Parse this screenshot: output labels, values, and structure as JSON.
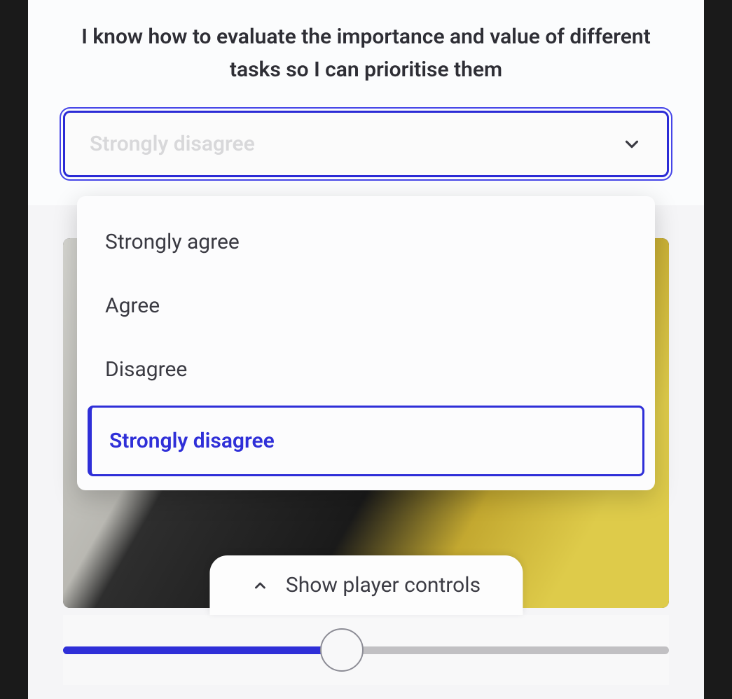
{
  "question": {
    "text": "I know how to evaluate the importance and value of different tasks so I can prioritise them"
  },
  "select": {
    "placeholder": "Strongly disagree",
    "options": [
      {
        "label": "Strongly agree",
        "selected": false
      },
      {
        "label": "Agree",
        "selected": false
      },
      {
        "label": "Disagree",
        "selected": false
      },
      {
        "label": "Strongly disagree",
        "selected": true
      }
    ]
  },
  "player": {
    "toggle_label": "Show player controls",
    "progress_percent": 46
  },
  "colors": {
    "accent": "#2f2fd8"
  }
}
